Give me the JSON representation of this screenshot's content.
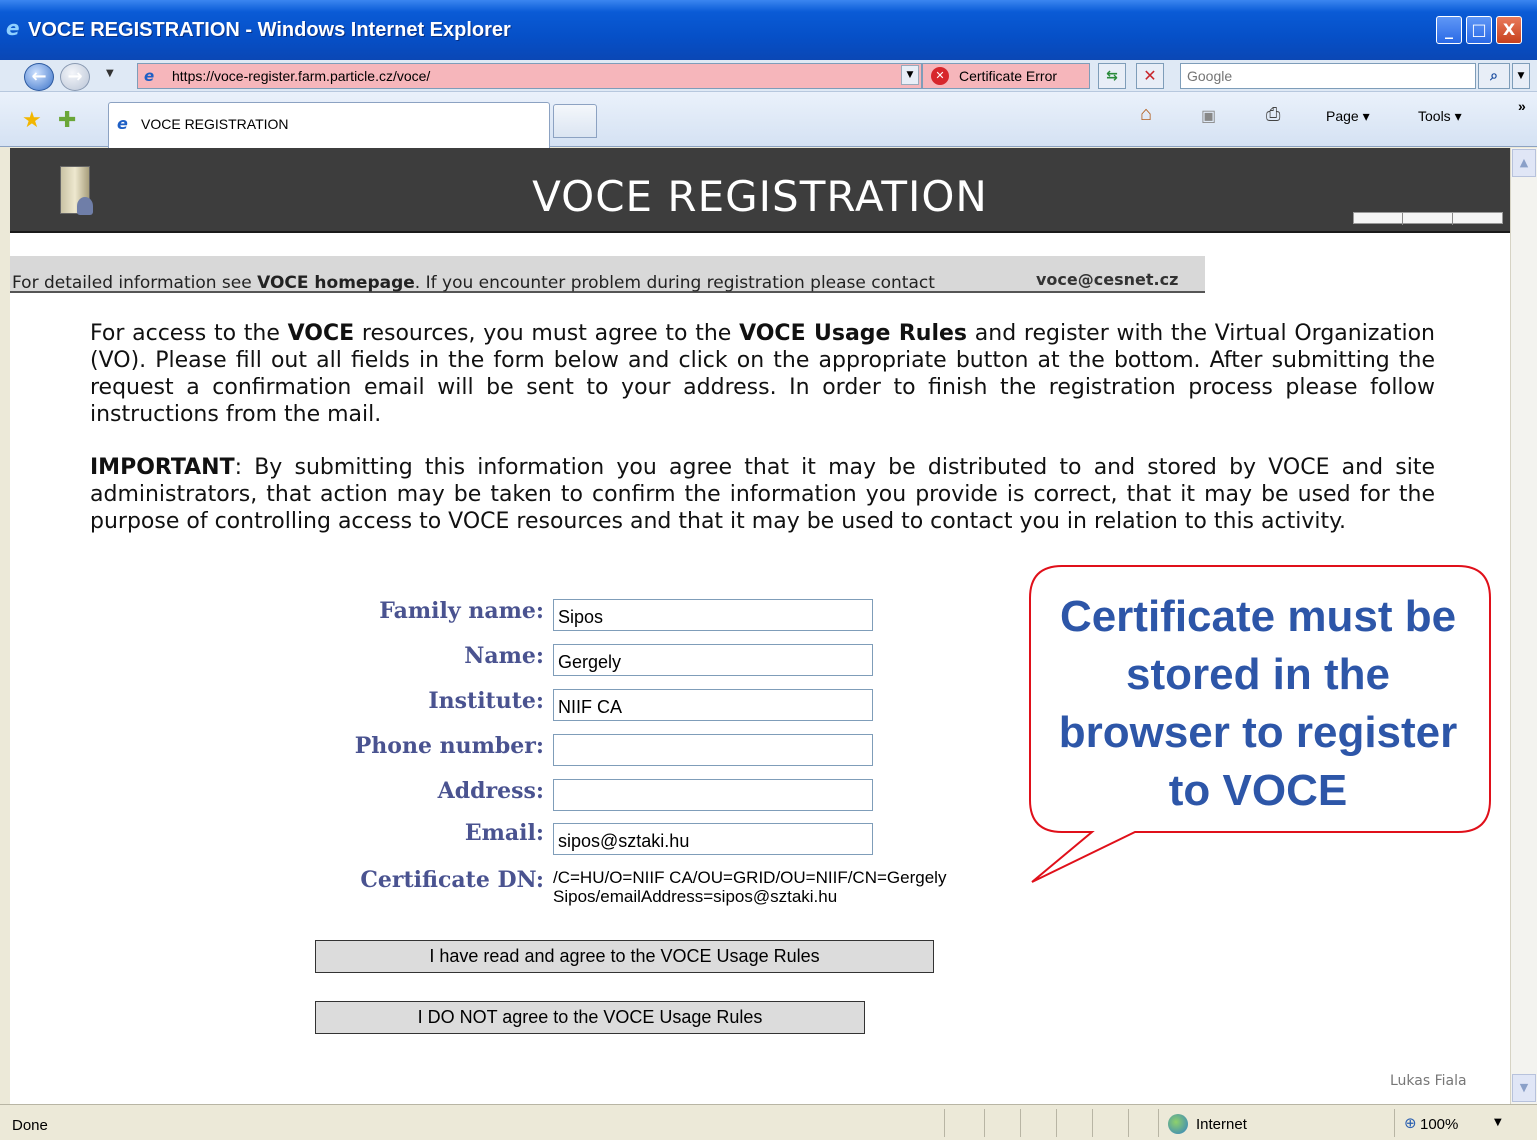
{
  "window": {
    "title": "VOCE REGISTRATION - Windows Internet Explorer",
    "min_glyph": "_",
    "max_glyph": "□",
    "close_glyph": "X"
  },
  "addressbar": {
    "url": "https://voce-register.farm.particle.cz/voce/",
    "certificate_error": "Certificate Error",
    "search_placeholder": "Google"
  },
  "tab": {
    "label": "VOCE REGISTRATION"
  },
  "commandbar": {
    "page_label": "Page ▾",
    "tools_label": "Tools ▾",
    "more": "»"
  },
  "page": {
    "title": "VOCE REGISTRATION",
    "info_prefix": "For detailed information see ",
    "info_link": "VOCE homepage",
    "info_suffix": ". If you encounter problem during registration please contact",
    "contact_email": "voce@cesnet.cz",
    "para1_a": "For access to the ",
    "para1_b": "VOCE",
    "para1_c": " resources, you must agree to the ",
    "para1_d": "VOCE Usage Rules",
    "para1_e": " and register with the Virtual Organization (VO). Please fill out all fields in the form below and click on the appropriate button at the bottom. After submitting the request a confirmation email will be sent to your address. In order to finish the registration process please follow instructions from the mail.",
    "para2_a": "IMPORTANT",
    "para2_b": ": By submitting this information you agree that it may be distributed to and stored by VOCE and site administrators, that action may be taken to confirm the information you provide is correct, that it may be used for the purpose of controlling access to VOCE resources and that it may be used to contact you in relation to this activity.",
    "author": "Lukas Fiala"
  },
  "form": {
    "family_label": "Family name:",
    "family_value": "Sipos",
    "name_label": "Name:",
    "name_value": "Gergely",
    "institute_label": "Institute:",
    "institute_value": "NIIF CA",
    "phone_label": "Phone number:",
    "phone_value": "",
    "address_label": "Address:",
    "address_value": "",
    "email_label": "Email:",
    "email_value": "sipos@sztaki.hu",
    "dn_label": "Certificate DN:",
    "dn_value": "/C=HU/O=NIIF CA/OU=GRID/OU=NIIF/CN=Gergely Sipos/emailAddress=sipos@sztaki.hu",
    "agree_button": "I have read and agree to the VOCE Usage Rules",
    "disagree_button": "I DO NOT agree to the VOCE Usage Rules"
  },
  "callout": {
    "text": "Certificate must be stored in the browser to register to VOCE",
    "border_color": "#e0101a",
    "text_color": "#2d56a8"
  },
  "statusbar": {
    "status": "Done",
    "zone": "Internet",
    "zoom": "100%"
  }
}
